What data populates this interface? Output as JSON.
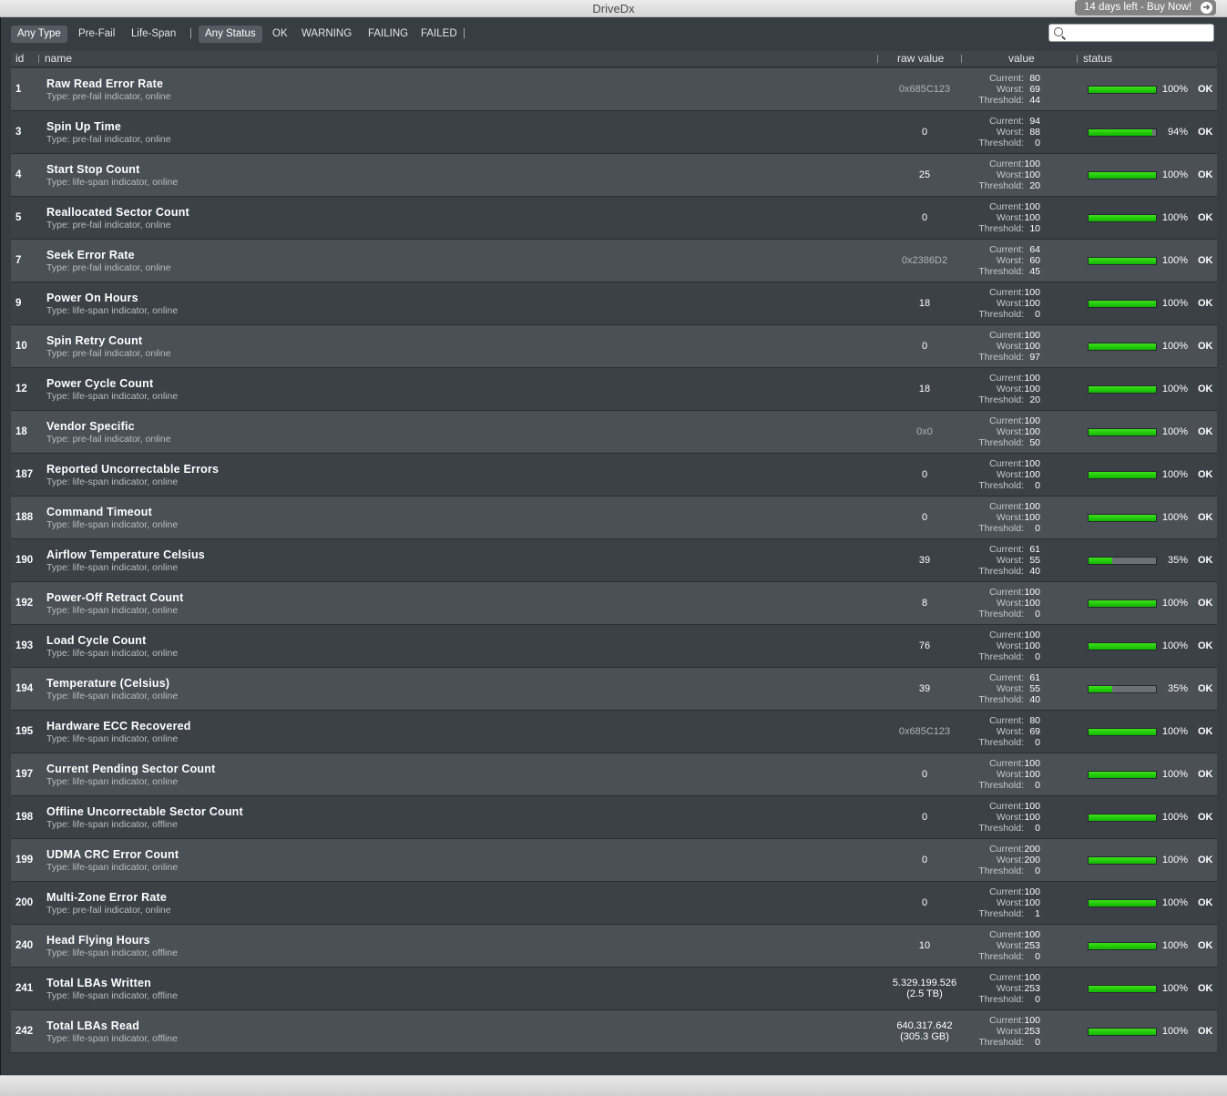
{
  "window": {
    "title": "DriveDx",
    "buy_label": "14 days left - Buy Now!",
    "buy_icon": "arrow-right-circle-icon"
  },
  "filters": {
    "type_options": [
      "Any Type",
      "Pre-Fail",
      "Life-Span"
    ],
    "status_options": [
      "Any Status",
      "OK",
      "WARNING",
      "FAILING",
      "FAILED"
    ],
    "separator": "|",
    "selected_type": "Any Type",
    "selected_status": "Any Status"
  },
  "search": {
    "value": "",
    "placeholder": ""
  },
  "columns": {
    "id": "id",
    "name": "name",
    "raw": "raw value",
    "value": "value",
    "status": "status"
  },
  "value_labels": {
    "current": "Current:",
    "worst": "Worst:",
    "threshold": "Threshold:"
  },
  "colors": {
    "bar_ok": "#22cc0a",
    "bar_empty": "#6a7076"
  },
  "attributes": [
    {
      "id": "1",
      "name": "Raw Read Error Rate",
      "type": "Type: pre-fail indicator, online",
      "raw": "0x685C123",
      "raw2": "",
      "current": "80",
      "worst": "69",
      "threshold": "44",
      "pct": "100%",
      "level": 100,
      "status": "OK"
    },
    {
      "id": "3",
      "name": "Spin Up Time",
      "type": "Type: pre-fail indicator, online",
      "raw": "0",
      "raw2": "",
      "current": "94",
      "worst": "88",
      "threshold": "0",
      "pct": "94%",
      "level": 94,
      "status": "OK"
    },
    {
      "id": "4",
      "name": "Start Stop Count",
      "type": "Type: life-span indicator, online",
      "raw": "25",
      "raw2": "",
      "current": "100",
      "worst": "100",
      "threshold": "20",
      "pct": "100%",
      "level": 100,
      "status": "OK"
    },
    {
      "id": "5",
      "name": "Reallocated Sector Count",
      "type": "Type: pre-fail indicator, online",
      "raw": "0",
      "raw2": "",
      "current": "100",
      "worst": "100",
      "threshold": "10",
      "pct": "100%",
      "level": 100,
      "status": "OK"
    },
    {
      "id": "7",
      "name": "Seek Error Rate",
      "type": "Type: pre-fail indicator, online",
      "raw": "0x2386D2",
      "raw2": "",
      "current": "64",
      "worst": "60",
      "threshold": "45",
      "pct": "100%",
      "level": 100,
      "status": "OK"
    },
    {
      "id": "9",
      "name": "Power On Hours",
      "type": "Type: life-span indicator, online",
      "raw": "18",
      "raw2": "",
      "current": "100",
      "worst": "100",
      "threshold": "0",
      "pct": "100%",
      "level": 100,
      "status": "OK"
    },
    {
      "id": "10",
      "name": "Spin Retry Count",
      "type": "Type: pre-fail indicator, online",
      "raw": "0",
      "raw2": "",
      "current": "100",
      "worst": "100",
      "threshold": "97",
      "pct": "100%",
      "level": 100,
      "status": "OK"
    },
    {
      "id": "12",
      "name": "Power Cycle Count",
      "type": "Type: life-span indicator, online",
      "raw": "18",
      "raw2": "",
      "current": "100",
      "worst": "100",
      "threshold": "20",
      "pct": "100%",
      "level": 100,
      "status": "OK"
    },
    {
      "id": "18",
      "name": "Vendor Specific",
      "type": "Type: pre-fail indicator, online",
      "raw": "0x0",
      "raw2": "",
      "current": "100",
      "worst": "100",
      "threshold": "50",
      "pct": "100%",
      "level": 100,
      "status": "OK"
    },
    {
      "id": "187",
      "name": "Reported Uncorrectable Errors",
      "type": "Type: life-span indicator, online",
      "raw": "0",
      "raw2": "",
      "current": "100",
      "worst": "100",
      "threshold": "0",
      "pct": "100%",
      "level": 100,
      "status": "OK"
    },
    {
      "id": "188",
      "name": "Command Timeout",
      "type": "Type: life-span indicator, online",
      "raw": "0",
      "raw2": "",
      "current": "100",
      "worst": "100",
      "threshold": "0",
      "pct": "100%",
      "level": 100,
      "status": "OK"
    },
    {
      "id": "190",
      "name": "Airflow Temperature Celsius",
      "type": "Type: life-span indicator, online",
      "raw": "39",
      "raw2": "",
      "current": "61",
      "worst": "55",
      "threshold": "40",
      "pct": "35%",
      "level": 35,
      "status": "OK"
    },
    {
      "id": "192",
      "name": "Power-Off Retract Count",
      "type": "Type: life-span indicator, online",
      "raw": "8",
      "raw2": "",
      "current": "100",
      "worst": "100",
      "threshold": "0",
      "pct": "100%",
      "level": 100,
      "status": "OK"
    },
    {
      "id": "193",
      "name": "Load Cycle Count",
      "type": "Type: life-span indicator, online",
      "raw": "76",
      "raw2": "",
      "current": "100",
      "worst": "100",
      "threshold": "0",
      "pct": "100%",
      "level": 100,
      "status": "OK"
    },
    {
      "id": "194",
      "name": "Temperature (Celsius)",
      "type": "Type: life-span indicator, online",
      "raw": "39",
      "raw2": "",
      "current": "61",
      "worst": "55",
      "threshold": "40",
      "pct": "35%",
      "level": 35,
      "status": "OK"
    },
    {
      "id": "195",
      "name": "Hardware ECC Recovered",
      "type": "Type: life-span indicator, online",
      "raw": "0x685C123",
      "raw2": "",
      "current": "80",
      "worst": "69",
      "threshold": "0",
      "pct": "100%",
      "level": 100,
      "status": "OK"
    },
    {
      "id": "197",
      "name": "Current Pending Sector Count",
      "type": "Type: life-span indicator, online",
      "raw": "0",
      "raw2": "",
      "current": "100",
      "worst": "100",
      "threshold": "0",
      "pct": "100%",
      "level": 100,
      "status": "OK"
    },
    {
      "id": "198",
      "name": "Offline Uncorrectable Sector Count",
      "type": "Type: life-span indicator, offline",
      "raw": "0",
      "raw2": "",
      "current": "100",
      "worst": "100",
      "threshold": "0",
      "pct": "100%",
      "level": 100,
      "status": "OK"
    },
    {
      "id": "199",
      "name": "UDMA CRC Error Count",
      "type": "Type: life-span indicator, online",
      "raw": "0",
      "raw2": "",
      "current": "200",
      "worst": "200",
      "threshold": "0",
      "pct": "100%",
      "level": 100,
      "status": "OK"
    },
    {
      "id": "200",
      "name": "Multi-Zone Error Rate",
      "type": "Type: pre-fail indicator, online",
      "raw": "0",
      "raw2": "",
      "current": "100",
      "worst": "100",
      "threshold": "1",
      "pct": "100%",
      "level": 100,
      "status": "OK"
    },
    {
      "id": "240",
      "name": "Head Flying Hours",
      "type": "Type: life-span indicator, offline",
      "raw": "10",
      "raw2": "",
      "current": "100",
      "worst": "253",
      "threshold": "0",
      "pct": "100%",
      "level": 100,
      "status": "OK"
    },
    {
      "id": "241",
      "name": "Total LBAs Written",
      "type": "Type: life-span indicator, offline",
      "raw": "5.329.199.526",
      "raw2": "(2.5 TB)",
      "current": "100",
      "worst": "253",
      "threshold": "0",
      "pct": "100%",
      "level": 100,
      "status": "OK"
    },
    {
      "id": "242",
      "name": "Total LBAs Read",
      "type": "Type: life-span indicator, offline",
      "raw": "640.317.642",
      "raw2": "(305.3 GB)",
      "current": "100",
      "worst": "253",
      "threshold": "0",
      "pct": "100%",
      "level": 100,
      "status": "OK"
    }
  ]
}
